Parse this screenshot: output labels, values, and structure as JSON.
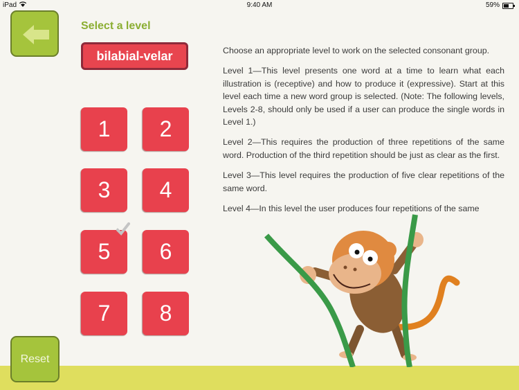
{
  "status_bar": {
    "device": "iPad",
    "time": "9:40 AM",
    "battery": "59%",
    "battery_level": 0.59
  },
  "back_button": {
    "icon": "arrow-left-icon"
  },
  "header": {
    "title": "Select a level",
    "selected_group": "bilabial-velar"
  },
  "levels": [
    {
      "label": "1",
      "completed": false
    },
    {
      "label": "2",
      "completed": false
    },
    {
      "label": "3",
      "completed": false
    },
    {
      "label": "4",
      "completed": false
    },
    {
      "label": "5",
      "completed": true
    },
    {
      "label": "6",
      "completed": false
    },
    {
      "label": "7",
      "completed": false
    },
    {
      "label": "8",
      "completed": false
    }
  ],
  "description": [
    "Choose an appropriate level to work on the selected consonant group.",
    "Level 1—This level presents one word at a time to learn what each illustration is (receptive) and how to produce it (expressive). Start at this level each time a new word group is selected. (Note: The following levels, Levels 2-8, should only be used if a user can produce the single words in Level 1.)",
    "Level 2—This requires the production of three repetitions of the same word. Production of the third repetition should be just as clear as the first.",
    "Level 3—This level requires the production of five clear repetitions of the same word.",
    "Level 4—In this level the user produces four repetitions of the same"
  ],
  "reset_button": {
    "label": "Reset"
  },
  "colors": {
    "accent_green": "#a5c43c",
    "level_red": "#e8414d",
    "title_green": "#8bae32",
    "ground_yellow": "#dfde5e",
    "background": "#f6f5f0"
  }
}
